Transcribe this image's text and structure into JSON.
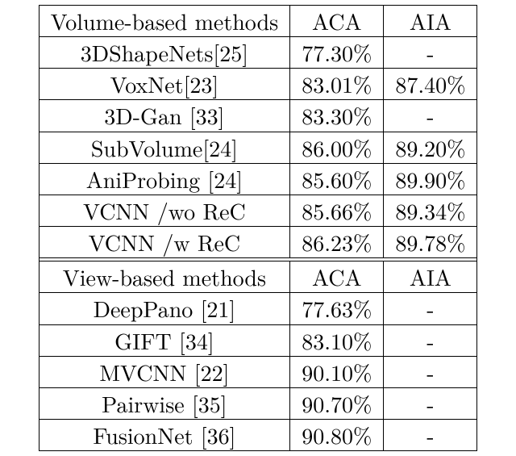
{
  "chart_data": [
    {
      "type": "table",
      "title": "Volume-based methods",
      "columns": [
        "Method",
        "ACA",
        "AIA"
      ],
      "rows": [
        {
          "method": "3DShapeNets[25]",
          "aca": 77.3,
          "aia": null
        },
        {
          "method": "VoxNet[23]",
          "aca": 83.01,
          "aia": 87.4
        },
        {
          "method": "3D-Gan [33]",
          "aca": 83.3,
          "aia": null
        },
        {
          "method": "SubVolume[24]",
          "aca": 86.0,
          "aia": 89.2
        },
        {
          "method": "AniProbing [24]",
          "aca": 85.6,
          "aia": 89.9
        },
        {
          "method": "VCNN /wo ReC",
          "aca": 85.66,
          "aia": 89.34,
          "bold": true
        },
        {
          "method": "VCNN /w ReC",
          "aca": 86.23,
          "aia": 89.78,
          "bold": true
        }
      ]
    },
    {
      "type": "table",
      "title": "View-based methods",
      "columns": [
        "Method",
        "ACA",
        "AIA"
      ],
      "rows": [
        {
          "method": "DeepPano [21]",
          "aca": 77.63,
          "aia": null
        },
        {
          "method": "GIFT [34]",
          "aca": 83.1,
          "aia": null
        },
        {
          "method": "MVCNN [22]",
          "aca": 90.1,
          "aia": null
        },
        {
          "method": "Pairwise [35]",
          "aca": 90.7,
          "aia": null
        },
        {
          "method": "FusionNet [36]",
          "aca": 90.8,
          "aia": null
        }
      ]
    }
  ],
  "headers": {
    "volume": "Volume-based methods",
    "view": "View-based methods",
    "aca": "ACA",
    "aia": "AIA"
  },
  "rows": {
    "v0": {
      "method": "3DShapeNets[25]",
      "aca": "77.30%",
      "aia": "-"
    },
    "v1": {
      "method": "VoxNet[23]",
      "aca": "83.01%",
      "aia": "87.40%"
    },
    "v2": {
      "method": "3D-Gan [33]",
      "aca": "83.30%",
      "aia": "-"
    },
    "v3": {
      "method": "SubVolume[24]",
      "aca": "86.00%",
      "aia": "89.20%"
    },
    "v4": {
      "method": "AniProbing [24]",
      "aca": "85.60%",
      "aia": "89.90%"
    },
    "v5": {
      "method": "VCNN /wo ReC",
      "aca": "85.66%",
      "aia": "89.34%"
    },
    "v6": {
      "method": "VCNN /w ReC",
      "aca": "86.23%",
      "aia": "89.78%"
    },
    "w0": {
      "method": "DeepPano [21]",
      "aca": "77.63%",
      "aia": "-"
    },
    "w1": {
      "method": "GIFT [34]",
      "aca": "83.10%",
      "aia": "-"
    },
    "w2": {
      "method": "MVCNN [22]",
      "aca": "90.10%",
      "aia": "-"
    },
    "w3": {
      "method": "Pairwise [35]",
      "aca": "90.70%",
      "aia": "-"
    },
    "w4": {
      "method": "FusionNet [36]",
      "aca": "90.80%",
      "aia": "-"
    }
  }
}
